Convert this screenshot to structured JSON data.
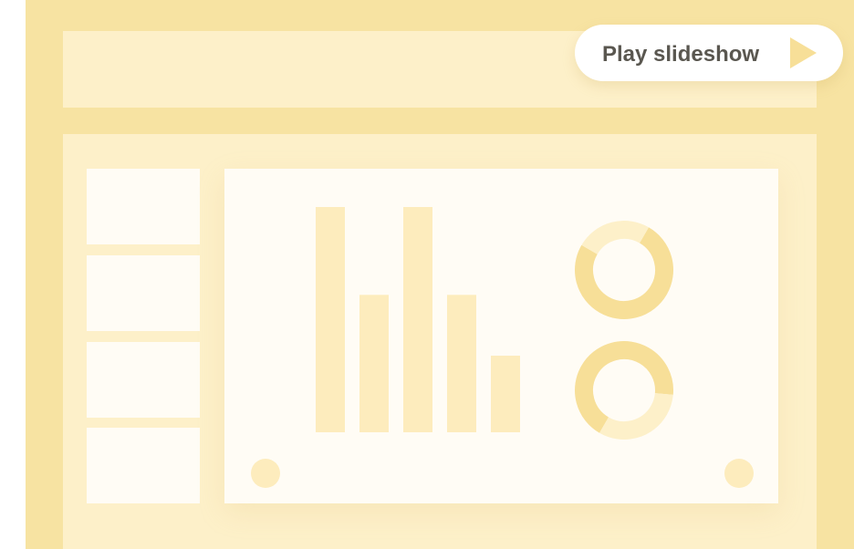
{
  "toolbar": {
    "play_label": "Play slideshow",
    "play_icon": "play-triangle-icon"
  },
  "thumbnails": {
    "count": 4
  },
  "slide": {
    "bar_chart": {
      "type": "bar",
      "bars": 5,
      "relative_values": [
        1.0,
        0.61,
        1.0,
        0.61,
        0.34
      ]
    },
    "donuts": [
      {
        "segments": [
          0.75,
          0.25
        ]
      },
      {
        "segments": [
          0.68,
          0.32
        ]
      }
    ]
  },
  "colors": {
    "frame": "#f7e3a2",
    "panel": "#fdf0c9",
    "slide_bg": "#fffcf5",
    "bar": "#fdecbd",
    "donut_main": "#f7df98",
    "donut_light": "#fdf0c9",
    "accent": "#f7df98"
  }
}
